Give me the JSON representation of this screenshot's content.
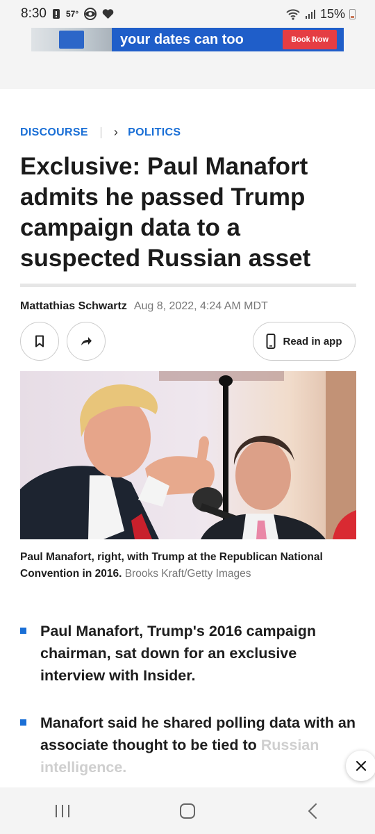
{
  "status_bar": {
    "time": "8:30",
    "temperature": "57°",
    "battery": "15%"
  },
  "ad": {
    "text": "your dates can too",
    "cta": "Book Now"
  },
  "breadcrumb": {
    "section": "DISCOURSE",
    "subsection": "POLITICS"
  },
  "article": {
    "headline": "Exclusive: Paul Manafort admits he passed Trump campaign data to a suspected Russian asset",
    "author": "Mattathias Schwartz",
    "date": "Aug 8, 2022, 4:24 AM MDT",
    "read_in_app_label": "Read in app",
    "caption": "Paul Manafort, right, with Trump at the Republican National Convention in 2016.",
    "credit": "Brooks Kraft/Getty Images",
    "bullets": [
      "Paul Manafort, Trump's 2016 campaign chairman, sat down for an exclusive interview with Insider.",
      "Manafort said he shared polling data with an associate thought to be tied to"
    ],
    "bullet_faded_tail": "Russian intelligence."
  },
  "colors": {
    "accent": "#1a6fd6",
    "ad_blue": "#1f5ec9",
    "ad_red": "#e53d43"
  },
  "icons": {
    "bookmark": "bookmark-icon",
    "share": "share-icon",
    "phone": "phone-icon",
    "close": "close-icon",
    "recents": "recents-icon",
    "home": "home-icon",
    "back": "back-icon"
  }
}
